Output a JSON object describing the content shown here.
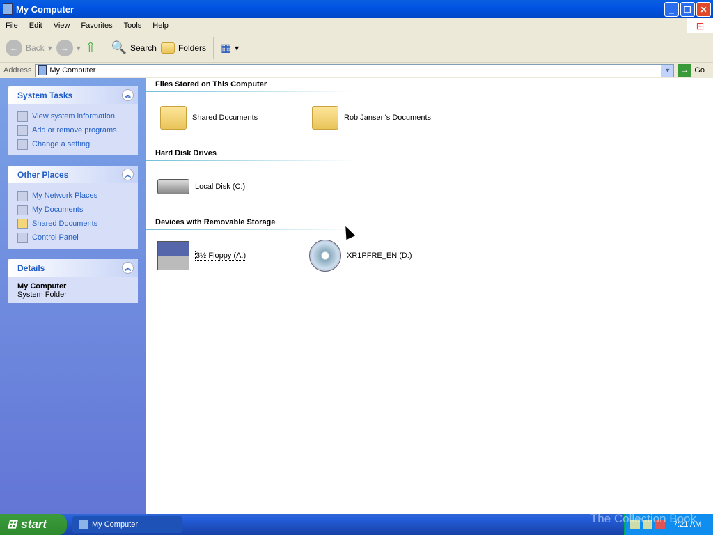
{
  "window": {
    "title": "My Computer"
  },
  "menu": [
    "File",
    "Edit",
    "View",
    "Favorites",
    "Tools",
    "Help"
  ],
  "toolbar": {
    "back": "Back",
    "search": "Search",
    "folders": "Folders"
  },
  "address": {
    "label": "Address",
    "value": "My Computer",
    "go": "Go"
  },
  "sidebar": {
    "system_tasks": {
      "title": "System Tasks",
      "items": [
        "View system information",
        "Add or remove programs",
        "Change a setting"
      ]
    },
    "other_places": {
      "title": "Other Places",
      "items": [
        "My Network Places",
        "My Documents",
        "Shared Documents",
        "Control Panel"
      ]
    },
    "details": {
      "title": "Details",
      "name": "My Computer",
      "type": "System Folder"
    }
  },
  "groups": [
    {
      "title": "Files Stored on This Computer",
      "items": [
        "Shared Documents",
        "Rob Jansen's Documents"
      ]
    },
    {
      "title": "Hard Disk Drives",
      "items": [
        "Local Disk (C:)"
      ]
    },
    {
      "title": "Devices with Removable Storage",
      "items": [
        "3½ Floppy (A:)",
        "XR1PFRE_EN (D:)"
      ]
    }
  ],
  "taskbar": {
    "start": "start",
    "task": "My Computer",
    "clock": "7:21 AM"
  },
  "watermark": "The Collection Book"
}
